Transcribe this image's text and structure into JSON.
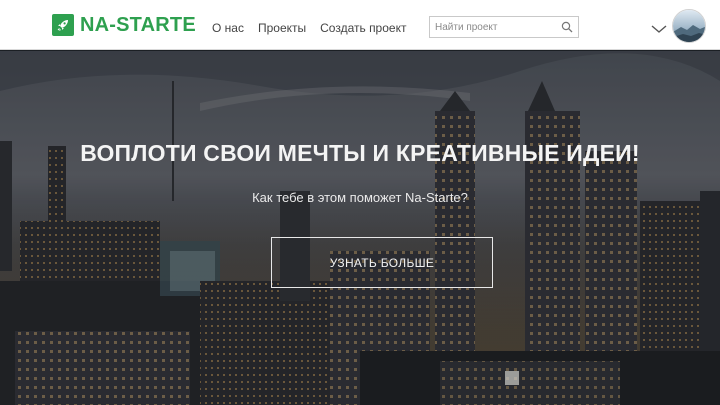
{
  "header": {
    "logo_text": "NA-STARTE",
    "nav": [
      {
        "label": "О нас"
      },
      {
        "label": "Проекты"
      },
      {
        "label": "Создать проект"
      }
    ],
    "search": {
      "placeholder": "Найти проект",
      "icon": "search-icon"
    },
    "user_menu_icon": "chevron-down-icon"
  },
  "hero": {
    "title": "ВОПЛОТИ СВОИ МЕЧТЫ И КРЕАТИВНЫЕ ИДЕИ!",
    "subtitle": "Как тебе в этом поможет Na-Starte?",
    "cta_label": "УЗНАТЬ БОЛЬШЕ"
  },
  "colors": {
    "brand": "#2ea04f",
    "nav_text": "#444444",
    "hero_text": "#f4f4f4"
  }
}
